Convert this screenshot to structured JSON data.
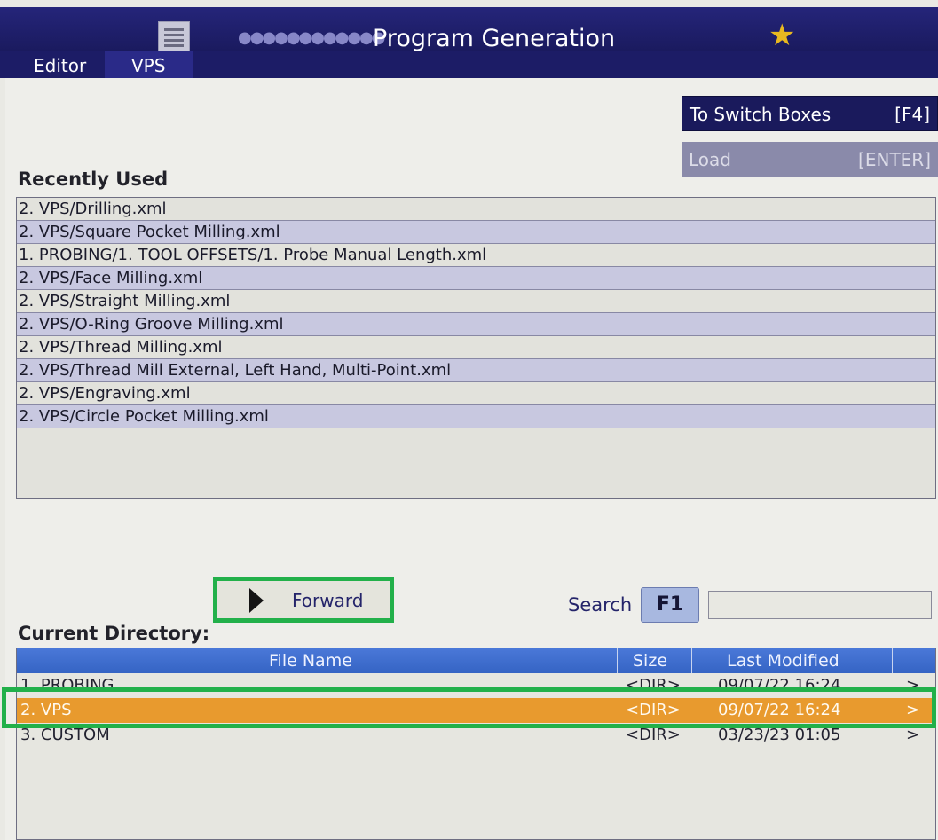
{
  "app": {
    "title": "Program Generation",
    "tabs": [
      "Editor",
      "VPS"
    ],
    "active_tab": "VPS"
  },
  "buttons": {
    "switch_label": "To Switch Boxes",
    "switch_key": "[F4]",
    "load_label": "Load",
    "load_key": "[ENTER]",
    "forward_label": "Forward"
  },
  "recent": {
    "heading": "Recently Used",
    "items": [
      "2. VPS/Drilling.xml",
      "2. VPS/Square Pocket Milling.xml",
      "1. PROBING/1. TOOL OFFSETS/1. Probe Manual Length.xml",
      "2. VPS/Face Milling.xml",
      "2. VPS/Straight Milling.xml",
      "2. VPS/O-Ring Groove Milling.xml",
      "2. VPS/Thread Milling.xml",
      "2. VPS/Thread Mill External, Left Hand, Multi-Point.xml",
      "2. VPS/Engraving.xml",
      "2. VPS/Circle Pocket Milling.xml"
    ]
  },
  "search": {
    "label": "Search",
    "key": "F1",
    "value": ""
  },
  "directory": {
    "heading": "Current Directory:",
    "columns": {
      "name": "File Name",
      "size": "Size",
      "modified": "Last Modified"
    },
    "rows": [
      {
        "name": "1. PROBING",
        "size": "<DIR>",
        "modified": "09/07/22 16:24",
        "arrow": ">"
      },
      {
        "name": "2. VPS",
        "size": "<DIR>",
        "modified": "09/07/22 16:24",
        "arrow": ">"
      },
      {
        "name": "3. CUSTOM",
        "size": "<DIR>",
        "modified": "03/23/23 01:05",
        "arrow": ">"
      }
    ],
    "selected_index": 1
  },
  "colors": {
    "title_bar": "#1a1a5e",
    "header_blue": "#3f6ed0",
    "selected_row": "#e89a2e",
    "highlight_green": "#22b04a",
    "star": "#e8b820"
  },
  "icons": {
    "menu": "menu-icon",
    "favorite": "star-icon",
    "forward": "play-arrow-icon"
  }
}
